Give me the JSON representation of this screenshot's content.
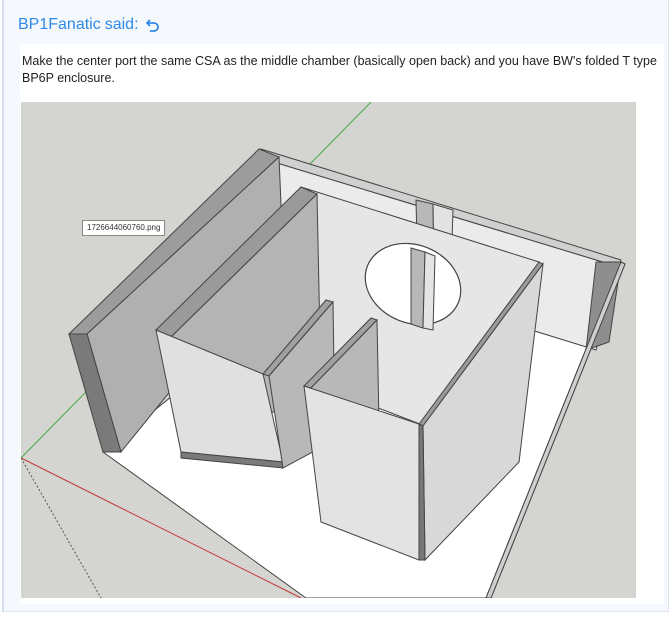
{
  "quote": {
    "author": "BP1Fanatic",
    "said_suffix": "said:",
    "jump_icon": "reply-arrow-icon",
    "text": "Make the center port the same CSA as the middle chamber (basically open back) and you have BW's folded T type BP6P enclosure.",
    "attachment": {
      "file_label": "1726644060760.png"
    }
  },
  "colors": {
    "link": "#2e8ae6",
    "quote_background": "#f5f8fc",
    "image_background": "#d4d4d0"
  }
}
